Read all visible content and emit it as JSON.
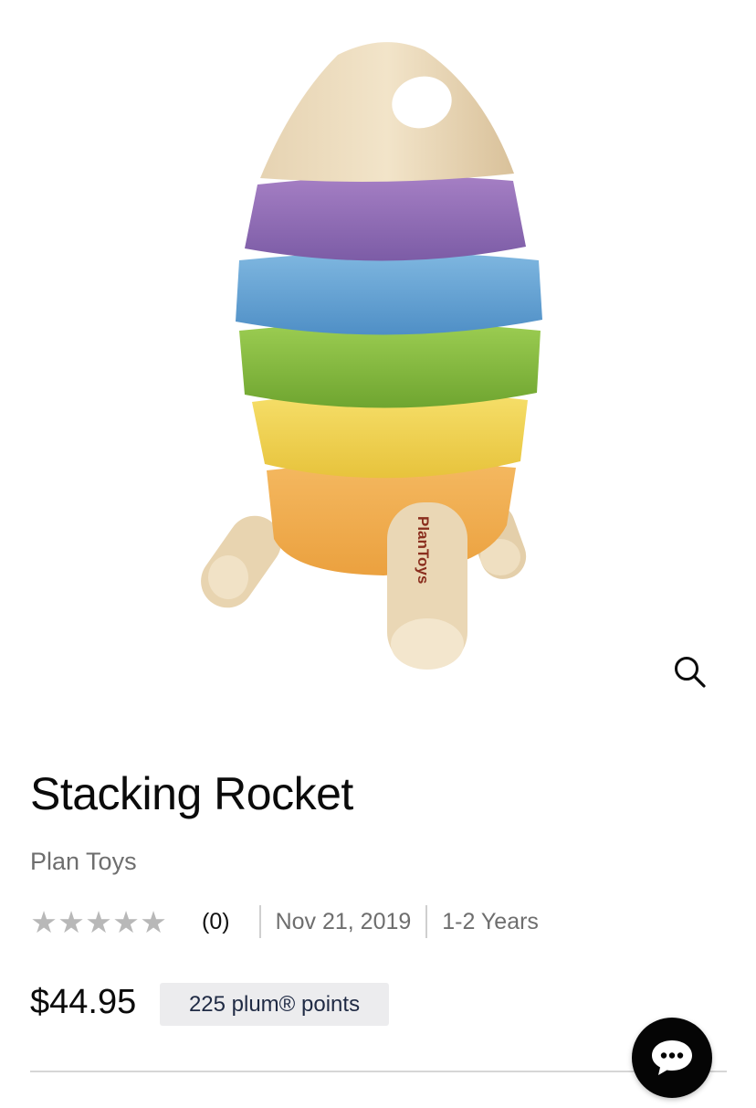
{
  "product": {
    "title": "Stacking Rocket",
    "brand": "Plan Toys",
    "image_brand_mark": "PlanToys",
    "rating": {
      "stars_filled": 0,
      "stars_total": 5,
      "count_text": "(0)"
    },
    "date": "Nov 21, 2019",
    "age_range": "1-2 Years",
    "price": "$44.95",
    "points_badge": "225 plum® points"
  },
  "icons": {
    "zoom": "search-icon",
    "chat": "chat-bubble-icon",
    "star": "star-icon"
  },
  "colors": {
    "star_empty": "#b8b8b8",
    "badge_bg": "#ececee",
    "badge_text": "#1f2a44",
    "chat_bg": "#050505"
  }
}
